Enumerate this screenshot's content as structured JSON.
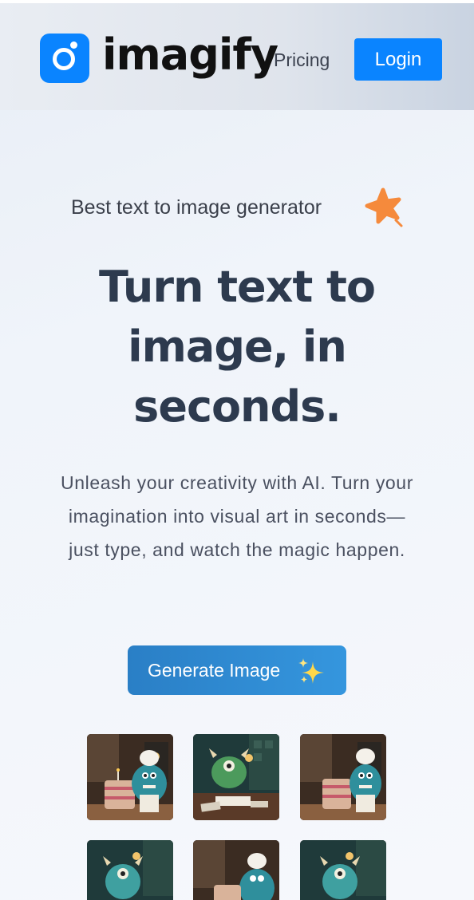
{
  "header": {
    "brand": "imagify",
    "nav_pricing": "Pricing",
    "login_label": "Login"
  },
  "hero": {
    "tagline": "Best text to image generator",
    "title_lines": [
      "Turn text to",
      "image, in",
      "seconds."
    ],
    "subtitle_lines": [
      "Unleash your creativity with AI. Turn your",
      "imagination into visual art in seconds—",
      "just type, and watch the magic happen."
    ],
    "cta_label": "Generate Image"
  },
  "gallery": {
    "images": [
      {
        "subject": "monster-chef-with-cake"
      },
      {
        "subject": "monster-reading-book"
      },
      {
        "subject": "monster-chef-with-cake"
      },
      {
        "subject": "monster-reading-book"
      },
      {
        "subject": "monster-chef-with-cake"
      },
      {
        "subject": "monster-reading-book"
      }
    ]
  },
  "colors": {
    "accent": "#0a84ff",
    "cta": "#2a7fc6",
    "star": "#f58a3c",
    "title": "#2d3a4e"
  },
  "icons": [
    "logo-icon",
    "star-icon",
    "sparkle-icon"
  ]
}
